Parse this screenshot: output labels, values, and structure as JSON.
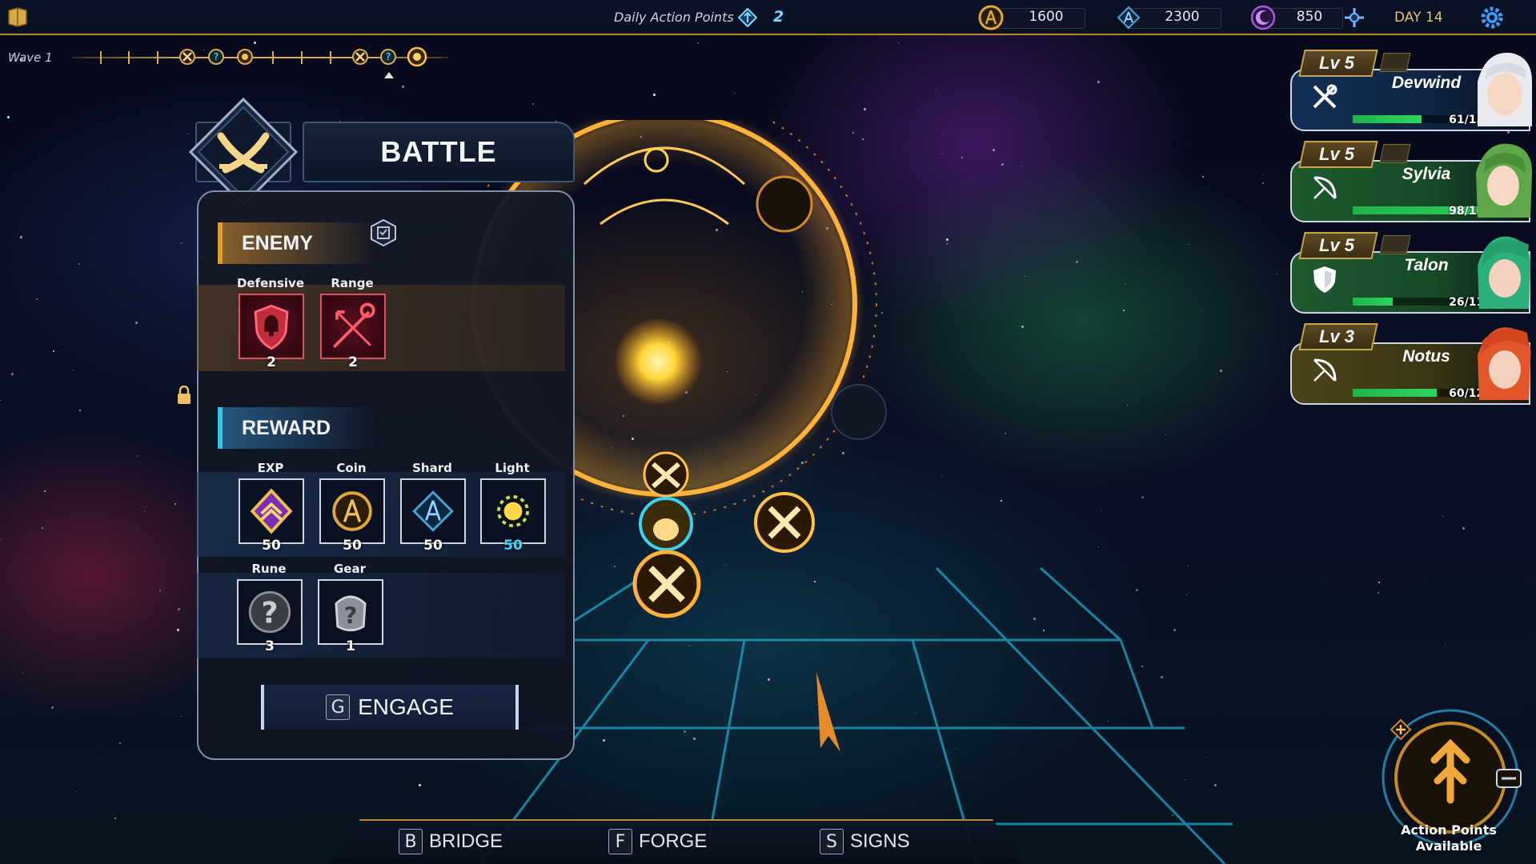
{
  "topbar": {
    "daily_action_points_label": "Daily Action Points",
    "daily_action_points_value": "2",
    "resources": [
      {
        "name": "coin",
        "icon": "coin-icon",
        "value": "1600",
        "color": "#e0a83a"
      },
      {
        "name": "shard",
        "icon": "shard-icon",
        "value": "2300",
        "color": "#4aa3d8"
      },
      {
        "name": "moon",
        "icon": "moon-icon",
        "value": "850",
        "color": "#a55bd8"
      }
    ],
    "day": "DAY 14"
  },
  "wave": {
    "label": "Wave 1",
    "nodes": [
      "battle",
      "unknown",
      "elite",
      "battle",
      "unknown",
      "boss"
    ]
  },
  "battle": {
    "title": "BATTLE",
    "enemy": {
      "heading": "ENEMY",
      "traits": [
        {
          "label": "Defensive",
          "count": "2",
          "icon": "shield-icon"
        },
        {
          "label": "Range",
          "count": "2",
          "icon": "staff-arrow-icon"
        }
      ]
    },
    "reward": {
      "heading": "REWARD",
      "row1": [
        {
          "label": "EXP",
          "value": "50",
          "icon": "exp-diamond-icon"
        },
        {
          "label": "Coin",
          "value": "50",
          "icon": "coin-icon"
        },
        {
          "label": "Shard",
          "value": "50",
          "icon": "shard-icon"
        },
        {
          "label": "Light",
          "value": "50",
          "icon": "sun-icon"
        }
      ],
      "row2": [
        {
          "label": "Rune",
          "value": "3",
          "icon": "question-rune-icon"
        },
        {
          "label": "Gear",
          "value": "1",
          "icon": "gear-armor-icon"
        }
      ]
    },
    "engage": {
      "key": "G",
      "label": "ENGAGE"
    }
  },
  "party": [
    {
      "level": "Lv 5",
      "name": "Devwind",
      "hp": "61/150",
      "hp_fraction": 0.41,
      "class_icon": "swords-icon",
      "theme": "blue"
    },
    {
      "level": "Lv 5",
      "name": "Sylvia",
      "hp": "98/100",
      "hp_fraction": 0.98,
      "class_icon": "bow-icon",
      "theme": "green"
    },
    {
      "level": "Lv 5",
      "name": "Talon",
      "hp": "26/110",
      "hp_fraction": 0.24,
      "class_icon": "shield-icon",
      "theme": "green"
    },
    {
      "level": "Lv 3",
      "name": "Notus",
      "hp": "60/120",
      "hp_fraction": 0.5,
      "class_icon": "bow-icon",
      "theme": "olive"
    }
  ],
  "nav": [
    {
      "key": "B",
      "label": "BRIDGE"
    },
    {
      "key": "F",
      "label": "FORGE"
    },
    {
      "key": "S",
      "label": "SIGNS"
    }
  ],
  "action_points": {
    "label_line1": "Action Points",
    "label_line2": "Available"
  },
  "colors": {
    "gold": "#d7ae57",
    "cyan": "#34c6e8",
    "orange": "#e59a2e",
    "enemy_red": "#e0505e"
  }
}
